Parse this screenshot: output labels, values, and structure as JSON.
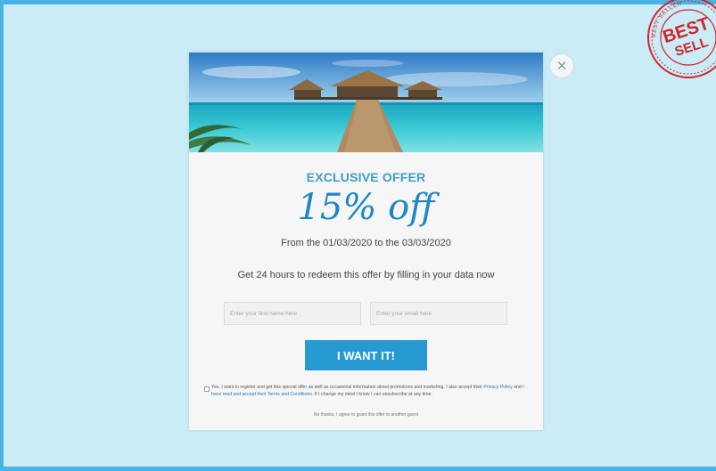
{
  "popup": {
    "close_glyph": "×",
    "eyebrow": "EXCLUSIVE OFFER",
    "headline": "15% off",
    "dates": "From the 01/03/2020 to the 03/03/2020",
    "redeem_text": "Get 24 hours to redeem this offer by filling in your data now",
    "first_name_placeholder": "Enter your first name here",
    "email_placeholder": "Enter your email here",
    "cta_label": "I WANT IT!",
    "consent": {
      "part1": "Yes, I want to register and get this special offer as well as occasional information about promotions and marketing. I also accept their ",
      "privacy_link": "Privacy Policy",
      "part2": " and ",
      "terms_link": "I have read and accept their Terms and Conditions",
      "part3": ". If I change my mind I know I can unsubscribe at any time."
    },
    "decline_link": "No thanks, I agree to grant this offer to another guest"
  },
  "seal": {
    "big_text": "BEST",
    "small_text": "SELL",
    "ring_text": "BEST SELLER"
  },
  "colors": {
    "background": "#c9ecf6",
    "frame": "#49b4e3",
    "accent": "#279ad4",
    "headline": "#1d87c4",
    "seal": "#d3222a"
  }
}
